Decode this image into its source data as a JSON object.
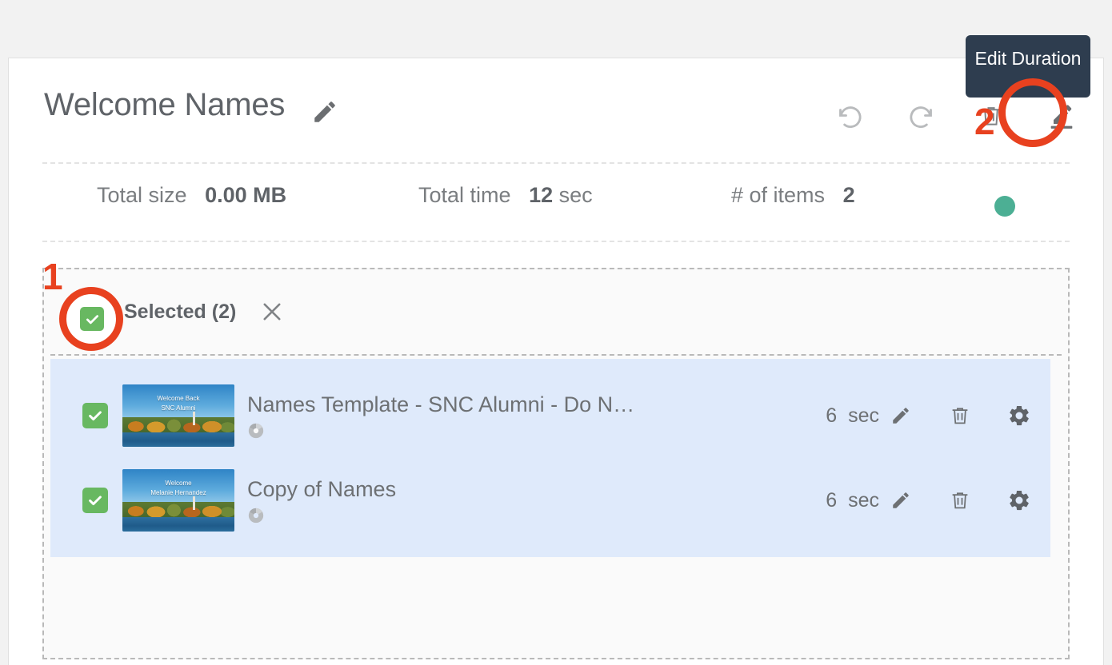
{
  "window": {
    "background_color": "#f2f2f2",
    "card_background": "#ffffff"
  },
  "header": {
    "title": "Welcome Names",
    "title_edit_icon": "pencil-icon",
    "toolbar": [
      {
        "name": "undo-button",
        "icon": "undo-icon",
        "label": "Undo"
      },
      {
        "name": "redo-button",
        "icon": "redo-icon",
        "label": "Redo"
      },
      {
        "name": "delete-button",
        "icon": "trash-icon",
        "label": "Delete"
      },
      {
        "name": "edit-duration-button",
        "icon": "border-color-pencil-icon",
        "label": "Edit Duration"
      }
    ]
  },
  "tooltip": {
    "text": "Edit Duration",
    "background_color": "#2e3d4f",
    "text_color": "#ffffff"
  },
  "stats": {
    "total_size_label": "Total size",
    "total_size_value": "0.00 MB",
    "total_time_label": "Total time",
    "total_time_value": "12",
    "total_time_unit": "sec",
    "item_count_label": "# of items",
    "item_count_value": "2",
    "status_dot_color": "#4caf94"
  },
  "selection": {
    "checkbox_checked": true,
    "checkbox_color": "#68b861",
    "label": "Selected (2)",
    "close_icon": "close-x-icon",
    "row_highlight_color": "#dfeafb"
  },
  "items": [
    {
      "checked": true,
      "title": "Names Template - SNC Alumni - Do N…",
      "thumbnail_caption_line1": "Welcome Back",
      "thumbnail_caption_line2": "SNC Alumni",
      "status_icon": "disc-spinner-icon",
      "duration_value": "6",
      "duration_unit": "sec",
      "edit_icon": "pencil-icon",
      "delete_icon": "trash-icon",
      "settings_icon": "gear-icon"
    },
    {
      "checked": true,
      "title": "Copy of Names",
      "thumbnail_caption_line1": "Welcome",
      "thumbnail_caption_line2": "Melanie Hernandez",
      "status_icon": "disc-spinner-icon",
      "duration_value": "6",
      "duration_unit": "sec",
      "edit_icon": "pencil-icon",
      "delete_icon": "trash-icon",
      "settings_icon": "gear-icon"
    }
  ],
  "annotations": {
    "color": "#e8411f",
    "markers": [
      {
        "number": "1",
        "target": "select-all-checkbox"
      },
      {
        "number": "2",
        "target": "edit-duration-button"
      }
    ]
  }
}
